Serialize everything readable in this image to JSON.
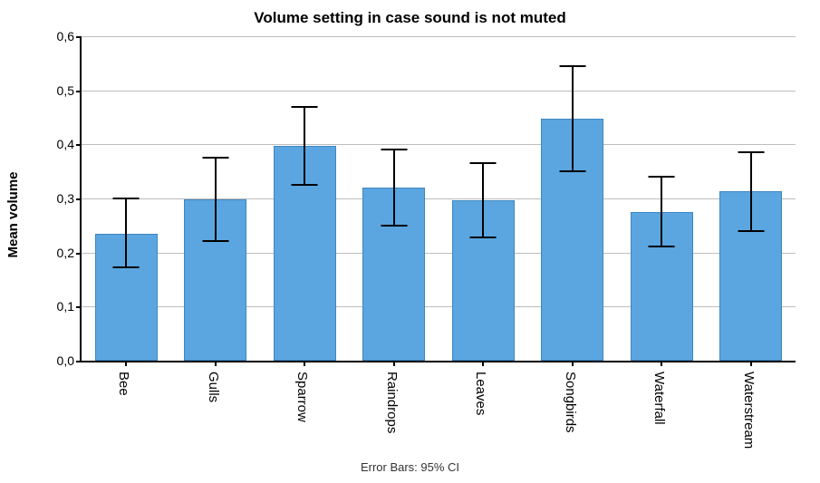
{
  "chart_data": {
    "type": "bar",
    "title": "Volume setting in case sound is not muted",
    "xlabel": "",
    "ylabel": "Mean volume",
    "ylim": [
      0.0,
      0.6
    ],
    "yticks": [
      0.0,
      0.1,
      0.2,
      0.3,
      0.4,
      0.5,
      0.6
    ],
    "ytick_labels": [
      "0,0",
      "0,1",
      "0,2",
      "0,3",
      "0,4",
      "0,5",
      "0,6"
    ],
    "categories": [
      "Bee",
      "Gulls",
      "Sparrow",
      "Raindrops",
      "Leaves",
      "Songbirds",
      "Waterfall",
      "Waterstream"
    ],
    "values": [
      0.235,
      0.298,
      0.398,
      0.32,
      0.297,
      0.447,
      0.275,
      0.313
    ],
    "error_low": [
      0.172,
      0.222,
      0.325,
      0.25,
      0.228,
      0.35,
      0.212,
      0.24
    ],
    "error_high": [
      0.3,
      0.375,
      0.47,
      0.39,
      0.365,
      0.545,
      0.34,
      0.385
    ],
    "footnote": "Error Bars: 95% CI",
    "bar_color": "#5ba6e0"
  }
}
